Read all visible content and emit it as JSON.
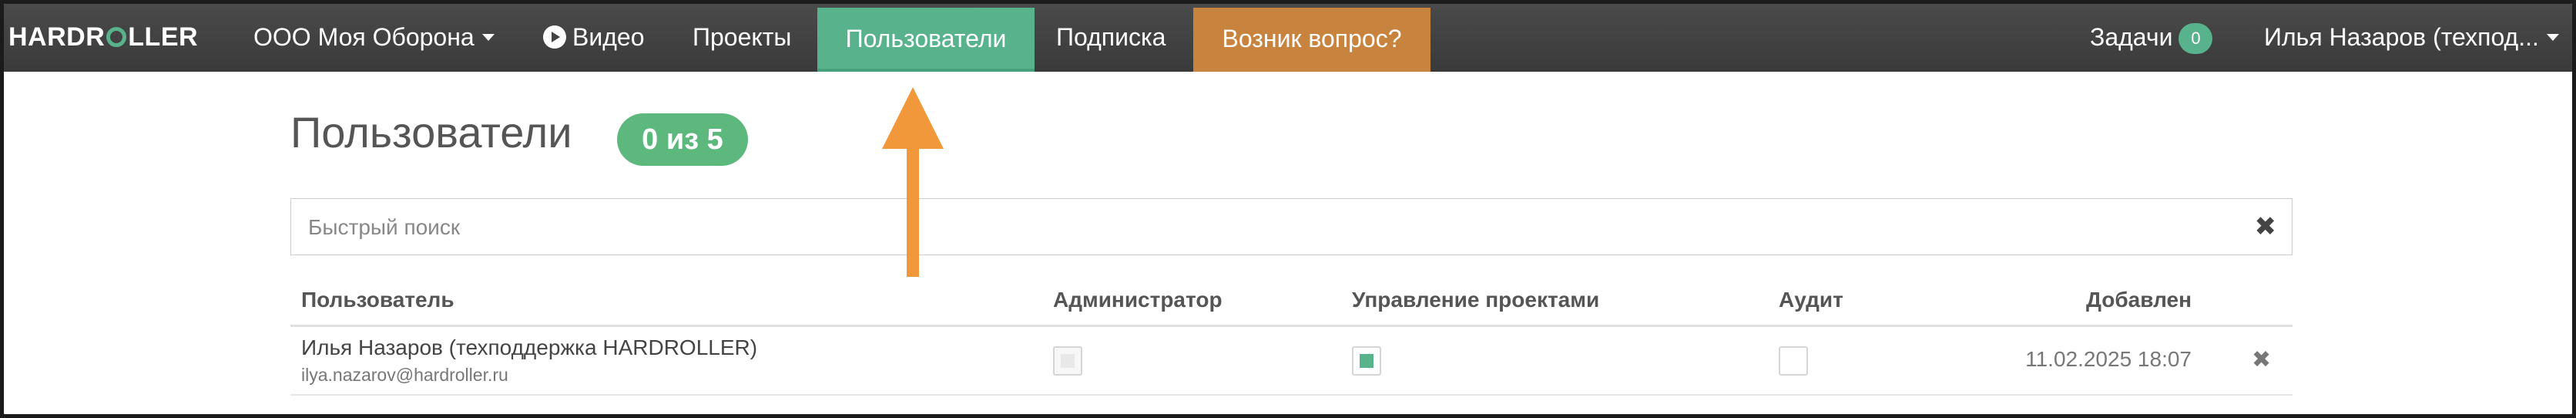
{
  "navbar": {
    "brand": {
      "prefix": "HARDR",
      "suffix": "LLER"
    },
    "org_label": "ООО Моя Оборона",
    "video_label": "Видео",
    "projects_label": "Проекты",
    "users_label": "Пользователи",
    "subscription_label": "Подписка",
    "question_label": "Возник вопрос?",
    "tasks_label": "Задачи",
    "tasks_count": "0",
    "user_label": "Илья Назаров (техпод..."
  },
  "page": {
    "title": "Пользователи",
    "count_badge": "0 из 5"
  },
  "search": {
    "placeholder": "Быстрый поиск",
    "value": ""
  },
  "table": {
    "headers": {
      "user": "Пользователь",
      "admin": "Администратор",
      "project_management": "Управление проектами",
      "audit": "Аудит",
      "added": "Добавлен"
    },
    "rows": [
      {
        "name": "Илья Назаров (техподдержка HARDROLLER)",
        "email": "ilya.nazarov@hardroller.ru",
        "admin": "disabled",
        "project_management": true,
        "audit": false,
        "added": "11.02.2025 18:07"
      }
    ]
  },
  "colors": {
    "accent_green": "#58b28b",
    "question_orange": "#c8843f",
    "annotation_arrow": "#f0983a"
  },
  "icons": {
    "clear_search": "close-icon",
    "row_delete": "close-icon",
    "video": "play-circle-icon"
  }
}
